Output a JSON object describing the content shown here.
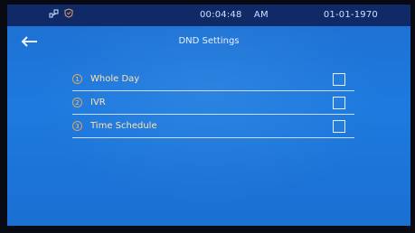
{
  "status": {
    "time": "00:04:48",
    "ampm": "AM",
    "date": "01-01-1970",
    "icons": [
      "network-icon",
      "shield-icon"
    ]
  },
  "header": {
    "title": "DND Settings",
    "back_icon": "arrow-left-icon"
  },
  "options": [
    {
      "index": "1",
      "label": "Whole Day",
      "checked": false
    },
    {
      "index": "2",
      "label": "IVR",
      "checked": false
    },
    {
      "index": "3",
      "label": "Time Schedule",
      "checked": false
    }
  ],
  "colors": {
    "screen_bg": "#1e7adf",
    "statusbar_bg": "#0f2a67",
    "label_text": "#ffe3b0",
    "index_badge": "#d9a75a"
  }
}
